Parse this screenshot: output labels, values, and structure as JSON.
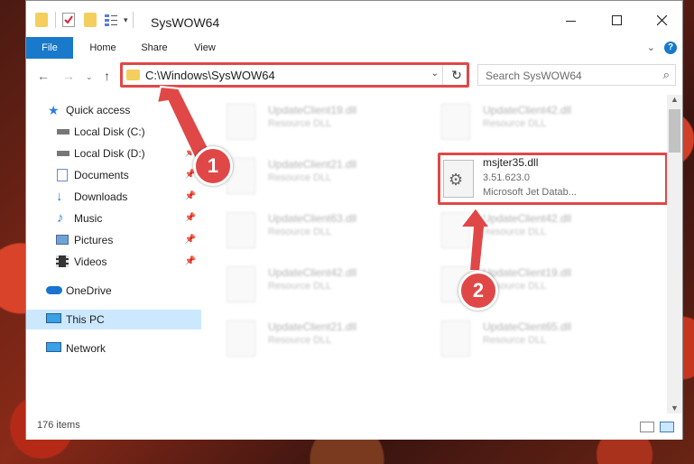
{
  "window": {
    "title": "SysWOW64"
  },
  "ribbon": {
    "tabs": [
      "File",
      "Home",
      "Share",
      "View"
    ],
    "help_label": "?"
  },
  "address": {
    "path": "C:\\Windows\\SysWOW64"
  },
  "search": {
    "placeholder": "Search SysWOW64"
  },
  "navpane": {
    "items": [
      {
        "label": "Quick access",
        "icon": "star-icon",
        "pinned": false
      },
      {
        "label": "Local Disk (C:)",
        "icon": "drive-icon",
        "pinned": false
      },
      {
        "label": "Local Disk (D:)",
        "icon": "drive-icon",
        "pinned": true
      },
      {
        "label": "Documents",
        "icon": "documents-icon",
        "pinned": true
      },
      {
        "label": "Downloads",
        "icon": "download-arrow-icon",
        "pinned": true
      },
      {
        "label": "Music",
        "icon": "music-note-icon",
        "pinned": true
      },
      {
        "label": "Pictures",
        "icon": "pictures-icon",
        "pinned": true
      },
      {
        "label": "Videos",
        "icon": "film-icon",
        "pinned": true
      },
      {
        "label": "OneDrive",
        "icon": "cloud-icon",
        "pinned": false
      },
      {
        "label": "This PC",
        "icon": "monitor-icon",
        "pinned": false
      },
      {
        "label": "Network",
        "icon": "network-icon",
        "pinned": false
      }
    ]
  },
  "files": [
    {
      "name": "UpdateClient19.dll",
      "type": "Resource DLL"
    },
    {
      "name": "UpdateClient42.dll",
      "type": "Resource DLL"
    },
    {
      "name": "UpdateClient21.dll",
      "type": "Resource DLL"
    },
    {
      "name": "UpdateClient63.dll",
      "type": "Resource DLL"
    },
    {
      "name": "UpdateClient42.dll",
      "type": "Resource DLL"
    },
    {
      "name": "UpdateClient42.dll",
      "type": "Resource DLL"
    },
    {
      "name": "UpdateClient19.dll",
      "type": "Resource DLL"
    },
    {
      "name": "UpdateClient21.dll",
      "type": "Resource DLL"
    },
    {
      "name": "UpdateClient65.dll",
      "type": "Resource DLL"
    }
  ],
  "highlighted_file": {
    "name": "msjter35.dll",
    "version": "3.51.623.0",
    "description": "Microsoft Jet Datab..."
  },
  "status": {
    "item_count": "176 items"
  },
  "annotations": {
    "badge1": "1",
    "badge2": "2",
    "color": "#e04848"
  }
}
